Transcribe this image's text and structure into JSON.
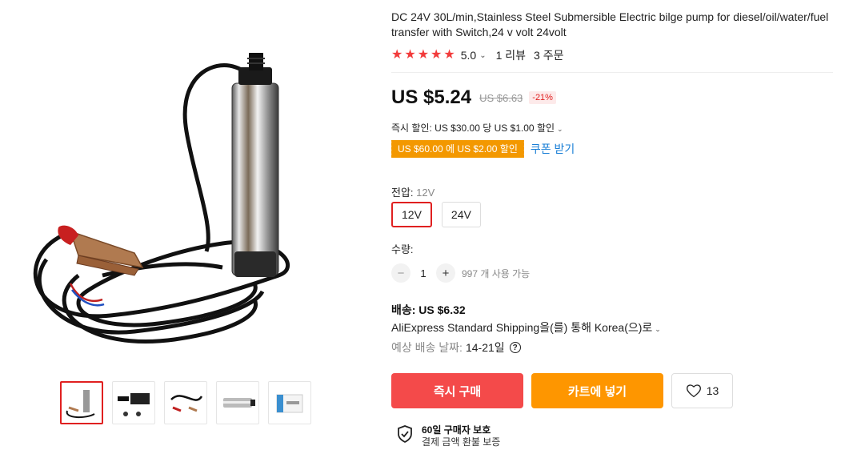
{
  "product": {
    "title": "DC 24V 30L/min,Stainless Steel Submersible Electric bilge pump for diesel/oil/water/fuel transfer with Switch,24 v volt 24volt",
    "rating": {
      "stars_icon": "star-icon",
      "star_count": 5,
      "value": "5.0",
      "reviews": "1 리뷰",
      "orders": "3 주문"
    },
    "price": {
      "current": "US $5.24",
      "original": "US $6.63",
      "discount": "-21%"
    },
    "promo": {
      "instant_discount": "즉시 할인: US $30.00 당 US $1.00 할인",
      "coupon_tag": "US $60.00 에 US $2.00 할인",
      "coupon_link": "쿠폰 받기"
    },
    "options": {
      "voltage_label": "전압:",
      "voltage_selected": "12V",
      "voltage_values": [
        "12V",
        "24V"
      ]
    },
    "quantity": {
      "label": "수량:",
      "value": "1",
      "available": "997 개 사용 가능"
    },
    "shipping": {
      "fee": "배송: US $6.32",
      "method": "AliExpress Standard Shipping을(를) 통해 Korea(으)로",
      "eta_label": "예상 배송 날짜:",
      "eta_value": "14-21일"
    },
    "actions": {
      "buy_now": "즉시 구매",
      "add_to_cart": "카트에 넣기",
      "wishlist_count": "13"
    },
    "protection": {
      "title": "60일 구매자 보호",
      "subtitle": "결제 금액 환불 보증"
    }
  },
  "colors": {
    "accent_red": "#f44a4a",
    "orange": "#fe9600",
    "coupon_orange": "#f39800",
    "link_blue": "#1a7fd6",
    "star_red": "#f23b3b"
  }
}
